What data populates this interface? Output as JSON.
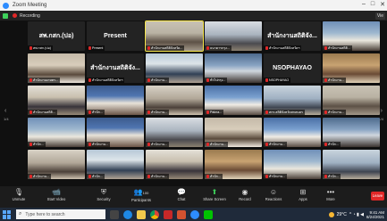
{
  "window": {
    "title": "Zoom Meeting",
    "controls": [
      "–",
      "□",
      "✕"
    ]
  },
  "recording": {
    "label": "Recording",
    "view_label": "Vie"
  },
  "gallery": {
    "prev_arrow": "‹",
    "next_arrow": "›",
    "page_left": "1/4",
    "page_right": "1/4",
    "tiles": [
      {
        "type": "name",
        "big": "สพ.กสก.(ปอ)",
        "label": "สพ.กสก.(ปอ)",
        "style": "v0"
      },
      {
        "type": "name",
        "big": "Present",
        "label": "Present",
        "style": "v0"
      },
      {
        "type": "video",
        "label": "สำนักงานสถิติจังหวัด...",
        "style": "v1",
        "active": true
      },
      {
        "type": "video",
        "label": "ธนาคารกรุง...",
        "style": "v2"
      },
      {
        "type": "name",
        "big": "สำนักงานสถิติจัง...",
        "label": "สำนักงานสถิติจังหวัดฯ",
        "style": "v0"
      },
      {
        "type": "video",
        "label": "สำนักงานสถิติ...",
        "style": "v3"
      },
      {
        "type": "video",
        "label": "สำนักงานเกษตร...",
        "style": "v4"
      },
      {
        "type": "name",
        "big": "สำนักงานสถิติจัง...",
        "label": "สำนักงานสถิติจังหวัดฯ",
        "style": "v0"
      },
      {
        "type": "video",
        "label": "สำนักงาน...",
        "style": "v5"
      },
      {
        "type": "video",
        "label": "ทั่วไปกรุง...",
        "style": "v6"
      },
      {
        "type": "name",
        "big": "NSOPHAYAO",
        "label": "NSOPHAYAO",
        "style": "v0"
      },
      {
        "type": "video",
        "label": "สำนักงาน...",
        "style": "v7"
      },
      {
        "type": "video",
        "label": "สำนักงานสถิติ...",
        "style": "v8"
      },
      {
        "type": "video",
        "label": "สำนัก...",
        "style": "v9"
      },
      {
        "type": "video",
        "label": "สำนักงาน...",
        "style": "v10"
      },
      {
        "type": "video",
        "label": "Pakna...",
        "style": "v11"
      },
      {
        "type": "video",
        "label": "สกร.สถิติจังหวัดสกลนคร",
        "style": "v12"
      },
      {
        "type": "video",
        "label": "สำนักงาน...",
        "style": "v1"
      },
      {
        "type": "video",
        "label": "สำนัก...",
        "style": "v3"
      },
      {
        "type": "video",
        "label": "สำนักงาน...",
        "style": "v9"
      },
      {
        "type": "video",
        "label": "สำนักงาน...",
        "style": "v2"
      },
      {
        "type": "video",
        "label": "สำนักงาน...",
        "style": "v4"
      },
      {
        "type": "video",
        "label": "สำนักงาน...",
        "style": "v11"
      },
      {
        "type": "video",
        "label": "สำนัก...",
        "style": "v6"
      },
      {
        "type": "video",
        "label": "สำนักงาน...",
        "style": "v10"
      },
      {
        "type": "video",
        "label": "สำนัก...",
        "style": "v5"
      },
      {
        "type": "video",
        "label": "สำนักงาน...",
        "style": "v8"
      },
      {
        "type": "video",
        "label": "สำนัก...",
        "style": "v7"
      },
      {
        "type": "video",
        "label": "สำนักงาน...",
        "style": "v3"
      },
      {
        "type": "video",
        "label": "สำนัก...",
        "style": "v12"
      }
    ]
  },
  "toolbar": {
    "unmute": "Unmute",
    "start_video": "Start Video",
    "security": "Security",
    "participants": "Participants",
    "participants_count": "100",
    "chat": "Chat",
    "share_screen": "Share Screen",
    "record": "Record",
    "reactions": "Reactions",
    "apps": "Apps",
    "more": "More",
    "leave": "Leave"
  },
  "taskbar": {
    "search_placeholder": "Type here to search",
    "temperature": "29°C",
    "time": "9:41 AM",
    "date": "8/24/2021"
  }
}
